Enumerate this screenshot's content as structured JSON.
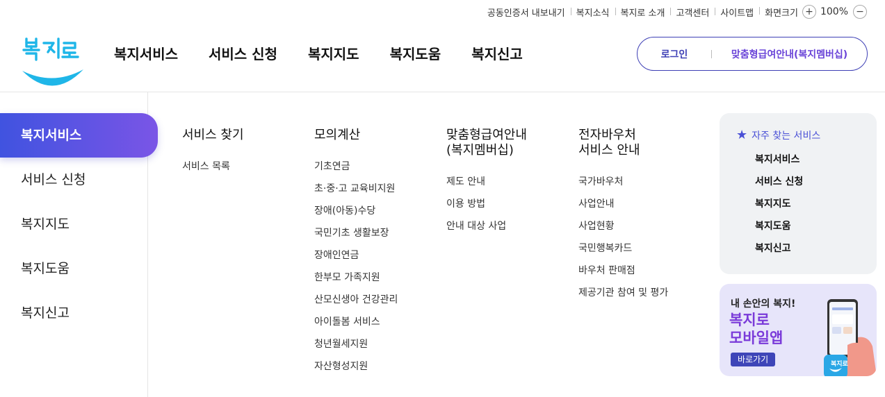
{
  "utility": {
    "items": [
      "공동인증서 내보내기",
      "복지소식",
      "복지로 소개",
      "고객센터",
      "사이트맵"
    ],
    "zoom_label": "화면크기",
    "zoom_in": "+",
    "zoom_value": "100%",
    "zoom_out": "−"
  },
  "logo": {
    "text": "복지로",
    "color": "#1fb6e8"
  },
  "gnb": [
    "복지서비스",
    "서비스 신청",
    "복지지도",
    "복지도움",
    "복지신고"
  ],
  "auth": {
    "login": "로그인",
    "member": "맞춤형급여안내(복지멤버십)"
  },
  "side_menu": {
    "active_index": 0,
    "items": [
      "복지서비스",
      "서비스 신청",
      "복지지도",
      "복지도움",
      "복지신고"
    ]
  },
  "columns": [
    {
      "title": "서비스 찾기",
      "links": [
        "서비스 목록"
      ]
    },
    {
      "title": "모의계산",
      "links": [
        "기초연금",
        "초·중·고 교육비지원",
        "장애(아동)수당",
        "국민기초 생활보장",
        "장애인연금",
        "한부모 가족지원",
        "산모신생아 건강관리",
        "아이돌봄 서비스",
        "청년월세지원",
        "자산형성지원"
      ],
      "highlighted_index": 9
    },
    {
      "title": "맞춤형급여안내\n(복지멤버십)",
      "links": [
        "제도 안내",
        "이용 방법",
        "안내 대상 사업"
      ]
    },
    {
      "title": "전자바우처\n서비스 안내",
      "links": [
        "국가바우처",
        "사업안내",
        "사업현황",
        "국민행복카드",
        "바우처 판매점",
        "제공기관 참여 및 평가"
      ]
    }
  ],
  "favorites": {
    "title": "자주 찾는 서비스",
    "icon": "star-icon",
    "links": [
      "복지서비스",
      "서비스 신청",
      "복지지도",
      "복지도움",
      "복지신고"
    ]
  },
  "app_banner": {
    "subtitle": "내 손안의 복지!",
    "title": "복지로\n모바일앱",
    "button": "바로가기",
    "app_icon_text": "복지로"
  },
  "colors": {
    "primary": "#3d3fb5",
    "accent_purple": "#6a44d8",
    "highlight": "#f6f313"
  }
}
